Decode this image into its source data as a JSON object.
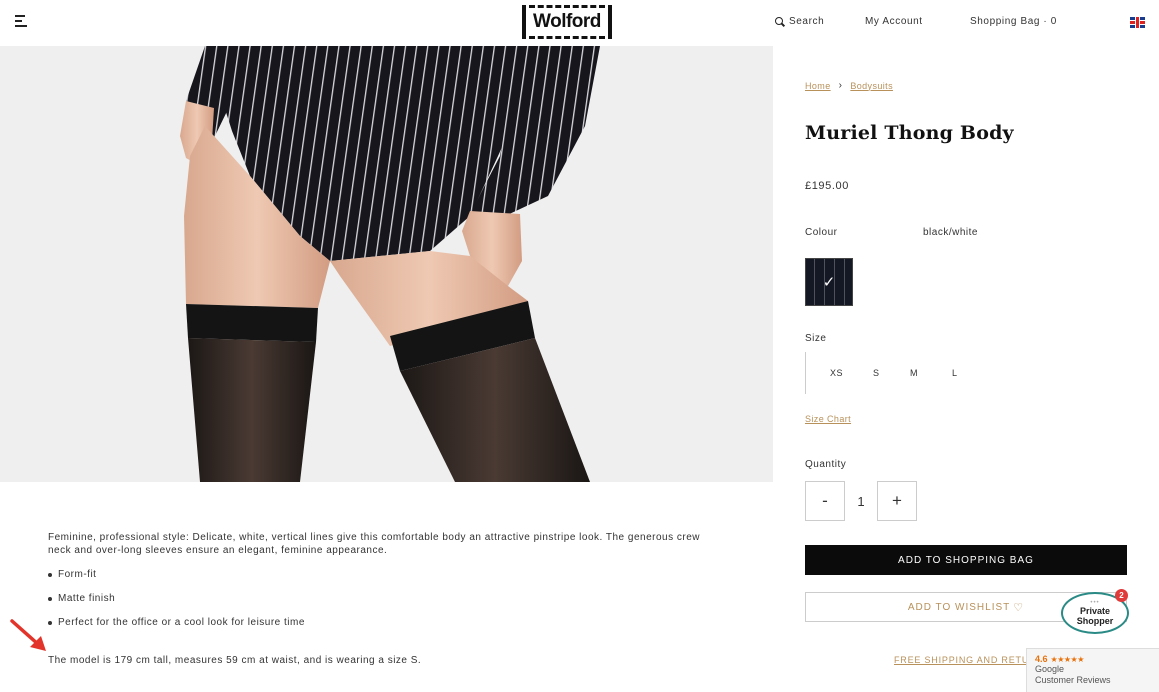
{
  "header": {
    "logo_text": "Wolford",
    "search_label": "Search",
    "account_label": "My Account",
    "bag_label": "Shopping Bag · 0"
  },
  "breadcrumb": {
    "items": [
      {
        "label": "Home"
      },
      {
        "label": "Bodysuits"
      }
    ],
    "separator": "›"
  },
  "product": {
    "title": "Muriel Thong Body",
    "price": "£195.00",
    "colour_label": "Colour",
    "colour_value": "black/white",
    "swatch_check": "✓",
    "size_label": "Size",
    "sizes": [
      "XS",
      "S",
      "M",
      "L"
    ],
    "size_chart_label": "Size Chart",
    "quantity_label": "Quantity",
    "quantity_minus": "-",
    "quantity_value": "1",
    "quantity_plus": "+",
    "add_to_bag_label": "ADD TO SHOPPING BAG",
    "add_to_wishlist_label": "ADD TO WISHLIST",
    "free_shipping_label": "FREE SHIPPING AND RETUR"
  },
  "description": {
    "text": "Feminine, professional style: Delicate, white, vertical lines give this comfortable body an attractive pinstripe look. The generous crew neck and over-long sleeves ensure an elegant, feminine appearance.",
    "bullets": [
      "Form-fit",
      "Matte finish",
      "Perfect for the office or a cool look for leisure time"
    ],
    "model_note": "The model is 179 cm tall, measures 59 cm at waist, and is wearing a size S."
  },
  "private_shopper": {
    "dots": "•••",
    "line1": "Private",
    "line2": "Shopper",
    "badge": "2"
  },
  "google_reviews": {
    "rating": "4.6",
    "stars": "★★★★★",
    "name": "Google",
    "subtitle": "Customer Reviews"
  },
  "colors": {
    "accent": "#b8915a",
    "button_dark": "#0b0b0b",
    "shopper_teal": "#2a8a85",
    "badge_red": "#e03a3a",
    "google_orange": "#e8710a"
  }
}
